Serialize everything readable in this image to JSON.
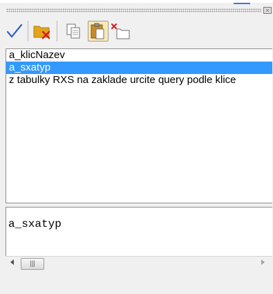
{
  "toolbar": {
    "buttons": [
      {
        "name": "confirm",
        "icon": "checkmark-icon"
      },
      {
        "name": "delete-item",
        "icon": "folder-delete-icon"
      },
      {
        "name": "copy",
        "icon": "copy-icon"
      },
      {
        "name": "paste",
        "icon": "paste-icon",
        "active": true
      },
      {
        "name": "clear",
        "icon": "clear-icon"
      }
    ]
  },
  "list": {
    "items": [
      {
        "text": "a_klicNazev",
        "selected": false
      },
      {
        "text": "a_sxatyp",
        "selected": true
      },
      {
        "text": "z tabulky RXS na zaklade urcite query podle klice",
        "selected": false
      }
    ]
  },
  "detail": {
    "value": "a_sxatyp"
  },
  "scrollbar": {
    "thumb_glyph": "|||"
  },
  "colors": {
    "selection": "#3399ff",
    "folder": "#e2a51c",
    "delete_x": "#d81f1f",
    "check": "#2d64c6"
  }
}
